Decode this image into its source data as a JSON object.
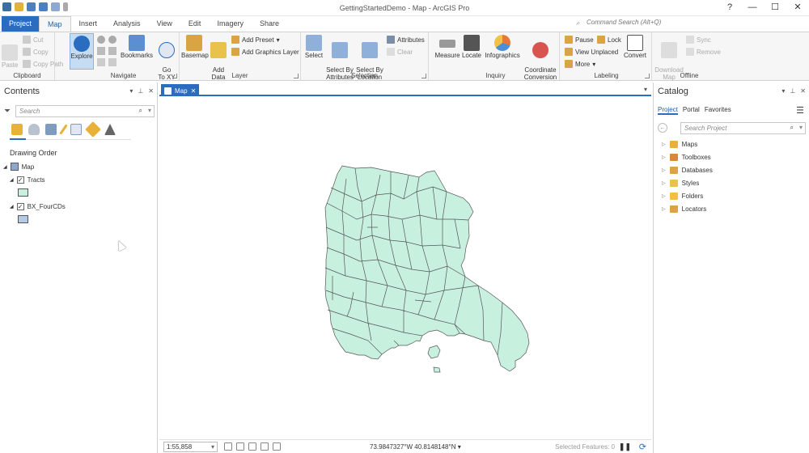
{
  "window": {
    "title": "GettingStartedDemo - Map - ArcGIS Pro",
    "help": "?",
    "minimize": "—",
    "maximize": "☐",
    "close": "✕"
  },
  "tabs": [
    "Project",
    "Map",
    "Insert",
    "Analysis",
    "View",
    "Edit",
    "Imagery",
    "Share"
  ],
  "command_search": {
    "placeholder": "Command Search (Alt+Q)"
  },
  "ribbon": {
    "clipboard": {
      "label": "Clipboard",
      "paste": "Paste",
      "cut": "Cut",
      "copy": "Copy",
      "copy_path": "Copy Path"
    },
    "navigate": {
      "label": "Navigate",
      "explore": "Explore",
      "bookmarks": "Bookmarks",
      "go_to_xy": "Go\nTo XY"
    },
    "layer": {
      "label": "Layer",
      "basemap": "Basemap",
      "add_data": "Add\nData",
      "add_preset": "Add Preset",
      "add_graphics_layer": "Add Graphics Layer"
    },
    "selection": {
      "label": "Selection",
      "select": "Select",
      "select_by_attributes": "Select By\nAttributes",
      "select_by_location": "Select By\nLocation",
      "attributes": "Attributes",
      "clear": "Clear"
    },
    "inquiry": {
      "label": "Inquiry",
      "measure": "Measure",
      "locate": "Locate",
      "infographics": "Infographics",
      "coordinate_conversion": "Coordinate\nConversion"
    },
    "labeling": {
      "label": "Labeling",
      "pause": "Pause",
      "lock": "Lock",
      "view_unplaced": "View Unplaced",
      "more": "More",
      "convert": "Convert"
    },
    "offline": {
      "label": "Offline",
      "download_map": "Download\nMap",
      "sync": "Sync",
      "remove": "Remove"
    }
  },
  "contents": {
    "title": "Contents",
    "search_placeholder": "Search",
    "drawing_order": "Drawing Order",
    "map_name": "Map",
    "layers": [
      {
        "name": "Tracts",
        "checked": true,
        "color": "#c8f0df"
      },
      {
        "name": "BX_FourCDs",
        "checked": true,
        "color": "#b3c9e6"
      }
    ]
  },
  "map_view": {
    "tab_label": "Map",
    "scale": "1:55,858",
    "coordinates": "73.9847327°W 40.8148148°N",
    "selected_features": "Selected Features: 0",
    "polygon_fill": "#c8f0df",
    "polygon_stroke": "#555555"
  },
  "catalog": {
    "title": "Catalog",
    "tabs": [
      "Project",
      "Portal",
      "Favorites"
    ],
    "search_placeholder": "Search Project",
    "items": [
      "Maps",
      "Toolboxes",
      "Databases",
      "Styles",
      "Folders",
      "Locators"
    ]
  },
  "colors": {
    "accent": "#2a6cbf",
    "ribbon_bg": "#f6f6f6"
  }
}
